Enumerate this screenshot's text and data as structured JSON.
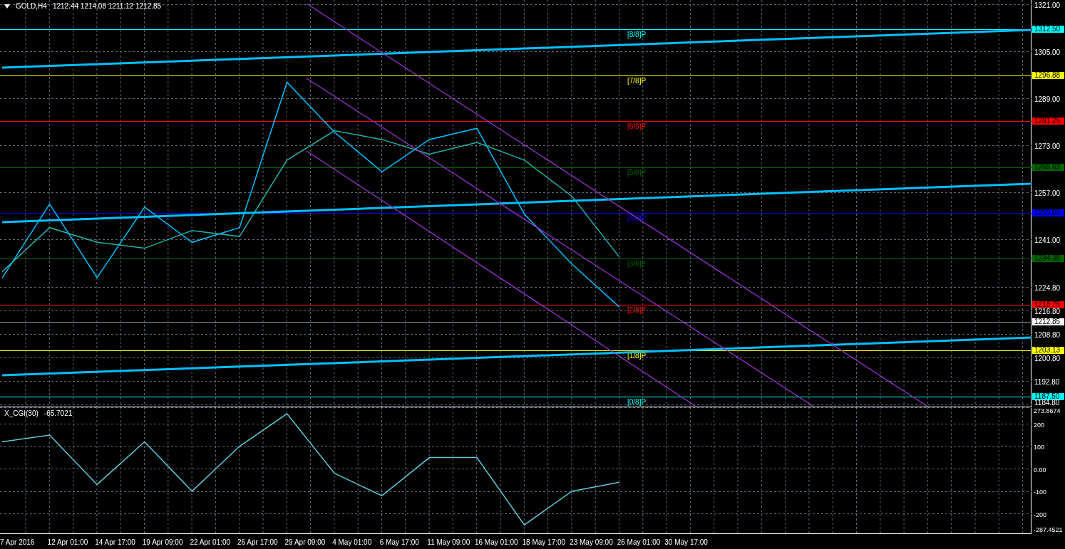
{
  "chart": {
    "quote": "1212.44 1214.08 1211.12 1212.85",
    "trendlines": [
      {
        "kind": "trendline",
        "color": "#00bfff"
      },
      {
        "kind": "trendline",
        "color": "#00bfff"
      },
      {
        "kind": "trendline",
        "color": "#00bfff"
      },
      {
        "kind": "channel",
        "color": "#9932cc"
      },
      {
        "kind": "channel",
        "color": "#9932cc"
      },
      {
        "kind": "channel",
        "color": "#9932cc"
      }
    ],
    "price_tags": [
      "1312.50",
      "1296.88",
      "1281.25",
      "1265.63",
      "1250.00",
      "1234.38",
      "1218.75",
      "1212.85",
      "1203.13",
      "1187.50"
    ],
    "chart_data": {
      "type": "line",
      "title": "GOLD,H4",
      "grid": true,
      "series": [
        {
          "color": "#00bfff",
          "values": [
            1227.8,
            1253,
            1228,
            1252,
            1240,
            1245,
            1294.5,
            1277.5,
            1264,
            1275,
            1278.8,
            1249.6,
            1232.6,
            1218,
            null
          ]
        },
        {
          "color": "#20b2aa",
          "values": [
            1230,
            1245,
            1240,
            1238,
            1244,
            1242,
            1268,
            1278,
            1275,
            1270,
            1274,
            1268,
            1255.7,
            1235,
            null
          ]
        }
      ],
      "ref_lines": [
        {
          "axis": "y",
          "value": 1312.5,
          "label": "[8/8]P",
          "color": "#00ffff"
        },
        {
          "axis": "y",
          "value": 1296.88,
          "label": "[7/8]P",
          "color": "#ffff00"
        },
        {
          "axis": "y",
          "value": 1281.25,
          "label": "[6/8]P",
          "color": "#ff0000"
        },
        {
          "axis": "y",
          "value": 1265.63,
          "label": "[5/8]P",
          "color": "#006400"
        },
        {
          "axis": "y",
          "value": 1250.0,
          "label": "[4/8]P",
          "color": "#0000ff"
        },
        {
          "axis": "y",
          "value": 1234.38,
          "label": "[3/8]P",
          "color": "#006400"
        },
        {
          "axis": "y",
          "value": 1218.75,
          "label": "[2/8]P",
          "color": "#ff0000"
        },
        {
          "axis": "y",
          "value": 1212.85,
          "color": "#8a94a0"
        },
        {
          "axis": "y",
          "value": 1203.13,
          "label": "[1/8]P",
          "color": "#ffff00"
        },
        {
          "axis": "y",
          "value": 1187.5,
          "label": "[0/8]P",
          "color": "#00ffff"
        }
      ],
      "ylim": [
        1184.1,
        1322.46
      ],
      "yticks": [
        {
          "value": 1321,
          "label": "1321.00"
        },
        {
          "value": 1305,
          "label": "1305.00"
        },
        {
          "value": 1289,
          "label": "1289.00"
        },
        {
          "value": 1273,
          "label": "1273.00"
        },
        {
          "value": 1257,
          "label": "1257.00"
        },
        {
          "value": 1241,
          "label": "1241.00"
        },
        {
          "value": 1224.8,
          "label": "1224.80"
        },
        {
          "value": 1216.8,
          "label": "1216.80"
        },
        {
          "value": 1208.8,
          "label": "1208.80"
        },
        {
          "value": 1200.8,
          "label": "1200.80"
        },
        {
          "value": 1192.8,
          "label": "1192.80"
        },
        {
          "value": 1184.8,
          "label": "1184.80"
        }
      ]
    }
  },
  "indicator": {
    "value": "-65.7021",
    "chart_data": {
      "type": "line",
      "title": "X_CGI(30)",
      "grid": true,
      "categories": [
        "7 Apr 2016",
        "12 Apr 01:00",
        "14 Apr 17:00",
        "19 Apr 09:00",
        "22 Apr 01:00",
        "26 Apr 17:00",
        "29 Apr 09:00",
        "4 May 01:00",
        "6 May 17:00",
        "11 May 09:00",
        "16 May 01:00",
        "18 May 17:00",
        "23 May 09:00",
        "26 May 01:00",
        "30 May 17:00"
      ],
      "series": [
        {
          "color": "#5fc8d8",
          "values": [
            120,
            150,
            -70,
            120,
            -100,
            100,
            245,
            -20,
            -120,
            50,
            50,
            -250,
            -100,
            -60,
            null
          ]
        }
      ],
      "ylim": [
        -287.4521,
        273.8674
      ],
      "yticks": [
        {
          "value": 273.8674,
          "label": "273.8674"
        },
        {
          "value": 200,
          "label": "200"
        },
        {
          "value": 100,
          "label": "100"
        },
        {
          "value": 0,
          "label": "0.00"
        },
        {
          "value": -100,
          "label": "-100"
        },
        {
          "value": -200,
          "label": "-200"
        },
        {
          "value": -287.4521,
          "label": "-287.4521"
        }
      ]
    }
  }
}
